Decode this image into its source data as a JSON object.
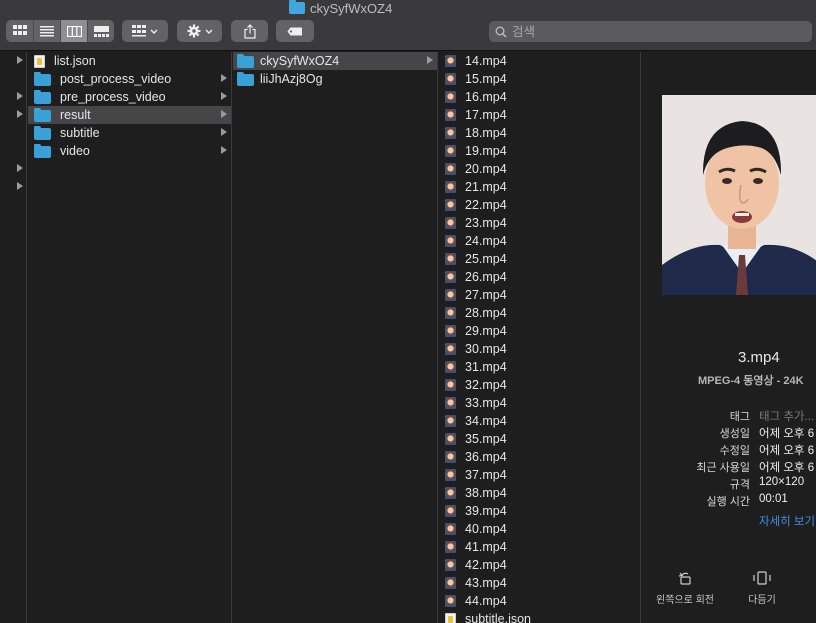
{
  "window": {
    "title": "ckySyfWxOZ4"
  },
  "toolbar": {
    "view_icons": [
      "icon-view-icon",
      "list-view-icon",
      "column-view-icon",
      "gallery-view-icon"
    ],
    "group_icon": "group-by-icon",
    "action_icon": "gear-icon",
    "share_icon": "share-icon",
    "tag_icon": "tag-icon"
  },
  "search": {
    "placeholder": "검색",
    "icon": "search-icon"
  },
  "columns": {
    "col1": [
      {
        "name": "list.json",
        "type": "json",
        "expandable": false
      },
      {
        "name": "post_process_video",
        "type": "folder",
        "expandable": true
      },
      {
        "name": "pre_process_video",
        "type": "folder",
        "expandable": true
      },
      {
        "name": "result",
        "type": "folder",
        "expandable": true,
        "selected": true
      },
      {
        "name": "subtitle",
        "type": "folder",
        "expandable": true
      },
      {
        "name": "video",
        "type": "folder",
        "expandable": true
      }
    ],
    "col2": [
      {
        "name": "ckySyfWxOZ4",
        "type": "folder",
        "expandable": true,
        "selected": true
      },
      {
        "name": "liiJhAzj8Og",
        "type": "folder",
        "expandable": false
      }
    ],
    "col3": [
      "14.mp4",
      "15.mp4",
      "16.mp4",
      "17.mp4",
      "18.mp4",
      "19.mp4",
      "20.mp4",
      "21.mp4",
      "22.mp4",
      "23.mp4",
      "24.mp4",
      "25.mp4",
      "26.mp4",
      "27.mp4",
      "28.mp4",
      "29.mp4",
      "30.mp4",
      "31.mp4",
      "32.mp4",
      "33.mp4",
      "34.mp4",
      "35.mp4",
      "36.mp4",
      "37.mp4",
      "38.mp4",
      "39.mp4",
      "40.mp4",
      "41.mp4",
      "42.mp4",
      "43.mp4",
      "44.mp4",
      "subtitle.json"
    ]
  },
  "preview": {
    "file_name": "3.mp4",
    "kind": "MPEG-4 동영상 - 24K",
    "metadata": [
      {
        "key": "태그",
        "value": "태그 추가...",
        "muted": true
      },
      {
        "key": "생성일",
        "value": "어제 오후 6"
      },
      {
        "key": "수정일",
        "value": "어제 오후 6"
      },
      {
        "key": "최근 사용일",
        "value": "어제 오후 6"
      },
      {
        "key": "규격",
        "value": "120×120"
      },
      {
        "key": "실행 시간",
        "value": "00:01"
      }
    ],
    "more_link": "자세히 보기",
    "actions": [
      {
        "label": "왼쪽으로 회전",
        "icon": "rotate-left-icon"
      },
      {
        "label": "다듬기",
        "icon": "trim-icon"
      }
    ]
  }
}
